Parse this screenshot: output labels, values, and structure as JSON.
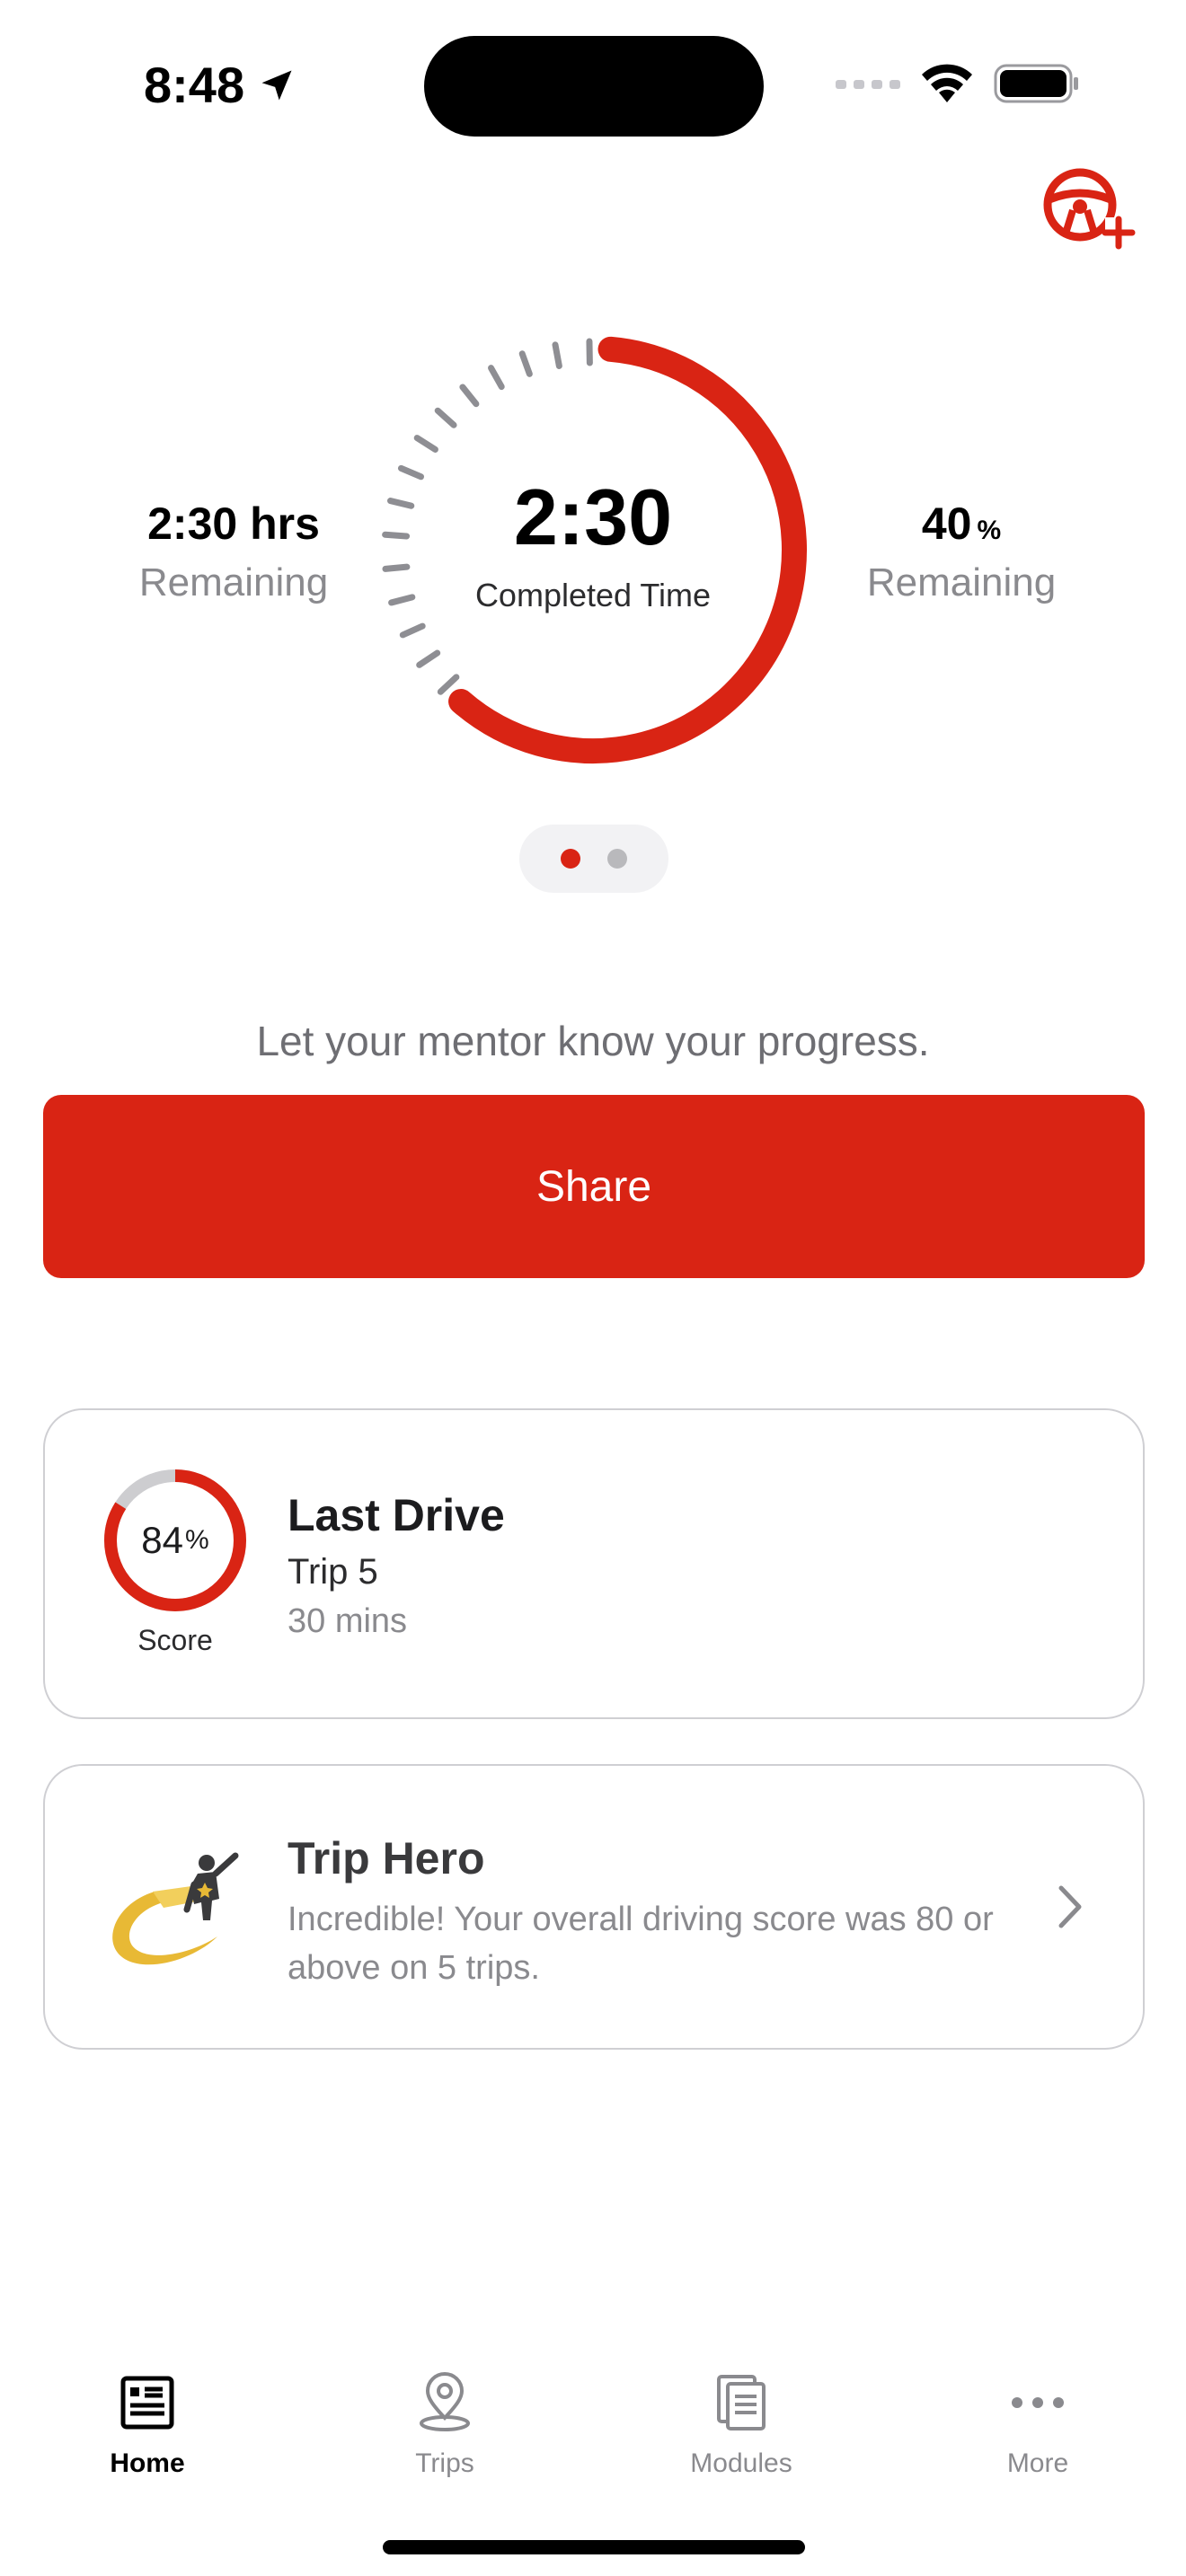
{
  "status_bar": {
    "time": "8:48",
    "icons": [
      "location-arrow-icon",
      "signal-icon",
      "wifi-icon",
      "battery-icon"
    ]
  },
  "header": {
    "action_icon": "steering-wheel-add-icon"
  },
  "progress": {
    "left_value": "2:30 hrs",
    "left_label": "Remaining",
    "center_value": "2:30",
    "center_label": "Completed Time",
    "right_value": "40",
    "right_unit": "%",
    "right_label": "Remaining",
    "completed_fraction": 0.6,
    "page_count": 2,
    "active_page": 0
  },
  "mentor": {
    "prompt": "Let your mentor know your progress.",
    "share_label": "Share"
  },
  "last_drive": {
    "score": "84",
    "score_unit": "%",
    "score_fraction": 0.84,
    "score_label": "Score",
    "title": "Last Drive",
    "trip": "Trip 5",
    "duration": "30 mins"
  },
  "achievement": {
    "title": "Trip Hero",
    "description": "Incredible! Your overall driving score was 80 or above on 5 trips.",
    "badge_icon": "trip-hero-badge-icon"
  },
  "tab_bar": {
    "tabs": [
      {
        "label": "Home",
        "icon": "home-document-icon",
        "active": true
      },
      {
        "label": "Trips",
        "icon": "map-pin-icon",
        "active": false
      },
      {
        "label": "Modules",
        "icon": "documents-icon",
        "active": false
      },
      {
        "label": "More",
        "icon": "more-dots-icon",
        "active": false
      }
    ]
  },
  "colors": {
    "accent": "#d92414",
    "secondary_text": "#8a8a8e",
    "tick_gray": "#8e8e93",
    "card_border": "#cfcfd3"
  }
}
